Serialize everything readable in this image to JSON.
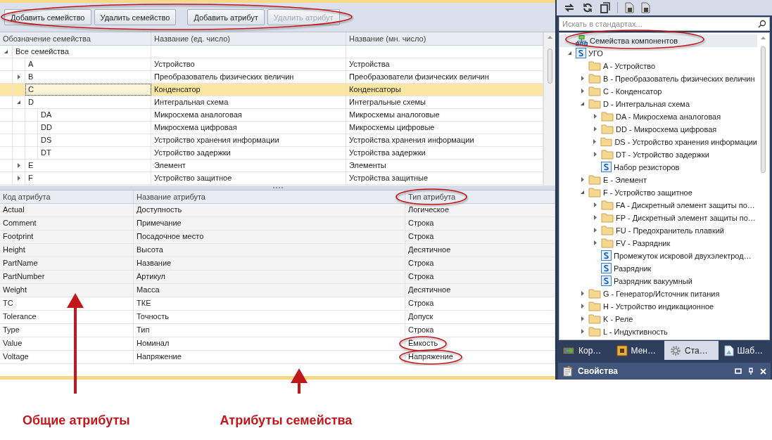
{
  "toolbar": {
    "buttons": [
      {
        "label": "Добавить семейство",
        "disabled": false
      },
      {
        "label": "Удалить семейство",
        "disabled": false
      },
      {
        "label": "Добавить атрибут",
        "disabled": false
      },
      {
        "label": "Удалить атрибут",
        "disabled": true
      }
    ]
  },
  "families": {
    "columns": [
      "Обозначение семейства",
      "Название (ед. число)",
      "Название (мн. число)"
    ],
    "rows": [
      {
        "code": "Все семейства",
        "singular": "",
        "plural": "",
        "expanded": true,
        "selected": false,
        "children": [
          {
            "code": "A",
            "singular": "Устройство",
            "plural": "Устройства",
            "selected": false
          },
          {
            "code": "B",
            "singular": "Преобразователь физических величин",
            "plural": "Преобразователи физических величин",
            "expanded": false,
            "selected": false
          },
          {
            "code": "C",
            "singular": "Конденсатор",
            "plural": "Конденсаторы",
            "selected": true
          },
          {
            "code": "D",
            "singular": "Интегральная схема",
            "plural": "Интегральные схемы",
            "expanded": true,
            "selected": false,
            "children": [
              {
                "code": "DA",
                "singular": "Микросхема аналоговая",
                "plural": "Микросхемы аналоговые",
                "selected": false
              },
              {
                "code": "DD",
                "singular": "Микросхема цифровая",
                "plural": "Микросхемы цифровые",
                "selected": false
              },
              {
                "code": "DS",
                "singular": "Устройство хранения информации",
                "plural": "Устройства хранения информации",
                "selected": false
              },
              {
                "code": "DT",
                "singular": "Устройство задержки",
                "plural": "Устройства задержки",
                "selected": false
              }
            ]
          },
          {
            "code": "E",
            "singular": "Элемент",
            "plural": "Элементы",
            "expanded": false,
            "selected": false
          },
          {
            "code": "F",
            "singular": "Устройство защитное",
            "plural": "Устройства защитные",
            "expanded": false,
            "selected": false
          }
        ]
      }
    ]
  },
  "attributes": {
    "columns": [
      "Код атрибута",
      "Название атрибута",
      "Тип атрибута"
    ],
    "rows": [
      {
        "kind": "common",
        "code": "Actual",
        "name": "Доступность",
        "type": "Логическое"
      },
      {
        "kind": "common",
        "code": "Comment",
        "name": "Примечание",
        "type": "Строка"
      },
      {
        "kind": "common",
        "code": "Footprint",
        "name": "Посадочное место",
        "type": "Строка"
      },
      {
        "kind": "common",
        "code": "Height",
        "name": "Высота",
        "type": "Десятичное"
      },
      {
        "kind": "common",
        "code": "PartName",
        "name": "Название",
        "type": "Строка"
      },
      {
        "kind": "common",
        "code": "PartNumber",
        "name": "Артикул",
        "type": "Строка"
      },
      {
        "kind": "common",
        "code": "Weight",
        "name": "Масса",
        "type": "Десятичное"
      },
      {
        "kind": "family",
        "code": "TC",
        "name": "ТКЕ",
        "type": "Строка"
      },
      {
        "kind": "family",
        "code": "Tolerance",
        "name": "Точность",
        "type": "Допуск"
      },
      {
        "kind": "family",
        "code": "Type",
        "name": "Тип",
        "type": "Строка"
      },
      {
        "kind": "family",
        "code": "Value",
        "name": "Номинал",
        "type": "Ёмкость"
      },
      {
        "kind": "family",
        "code": "Voltage",
        "name": "Напряжение",
        "type": "Напряжение"
      }
    ]
  },
  "annotations": [
    "Общие атрибуты",
    "Атрибуты семейства"
  ],
  "standards": {
    "search": {
      "placeholder": "Искать в стандартах..."
    },
    "tree": [
      {
        "label": "Семейства компонентов",
        "kind": "families"
      },
      {
        "label": "УГО",
        "kind": "symbol",
        "expanded": true,
        "children": [
          {
            "label": "A - Устройство",
            "kind": "folder"
          },
          {
            "label": "B - Преобразователь физических величин",
            "kind": "folder",
            "expanded": false
          },
          {
            "label": "C - Конденсатор",
            "kind": "folder",
            "expanded": false
          },
          {
            "label": "D - Интегральная схема",
            "kind": "folder",
            "expanded": true,
            "children": [
              {
                "label": "DA - Микросхема аналоговая",
                "kind": "folder",
                "expanded": false
              },
              {
                "label": "DD - Микросхема цифровая",
                "kind": "folder",
                "expanded": false
              },
              {
                "label": "DS - Устройство хранения информации",
                "kind": "folder",
                "expanded": false
              },
              {
                "label": "DT - Устройство задержки",
                "kind": "folder",
                "expanded": false
              },
              {
                "label": "Набор резисторов",
                "kind": "symbol"
              }
            ]
          },
          {
            "label": "E - Элемент",
            "kind": "folder",
            "expanded": false
          },
          {
            "label": "F - Устройство защитное",
            "kind": "folder",
            "expanded": true,
            "children": [
              {
                "label": "FA - Дискретный элемент защиты по…",
                "kind": "folder",
                "expanded": false
              },
              {
                "label": "FP - Дискретный элемент защиты по…",
                "kind": "folder",
                "expanded": false
              },
              {
                "label": "FU - Предохранитель плавкий",
                "kind": "folder",
                "expanded": false
              },
              {
                "label": "FV - Разрядник",
                "kind": "folder",
                "expanded": false
              },
              {
                "label": "Промежуток искровой двухэлектрод…",
                "kind": "symbol"
              },
              {
                "label": "Разрядник",
                "kind": "symbol"
              },
              {
                "label": "Разрядник вакуумный",
                "kind": "symbol"
              }
            ]
          },
          {
            "label": "G - Генератор/Источник питания",
            "kind": "folder",
            "expanded": false
          },
          {
            "label": "H - Устройство индикационное",
            "kind": "folder",
            "expanded": false
          },
          {
            "label": "K - Реле",
            "kind": "folder",
            "expanded": false
          },
          {
            "label": "L - Индуктивность",
            "kind": "folder",
            "expanded": false
          }
        ]
      }
    ],
    "tabs": [
      {
        "label": "Кор…",
        "kind": "chip",
        "selected": false
      },
      {
        "label": "Мен…",
        "kind": "board",
        "selected": false
      },
      {
        "label": "Ста…",
        "kind": "gear",
        "selected": true
      },
      {
        "label": "Шаб…",
        "kind": "page",
        "selected": false
      }
    ]
  },
  "properties": {
    "title": "Свойства"
  }
}
